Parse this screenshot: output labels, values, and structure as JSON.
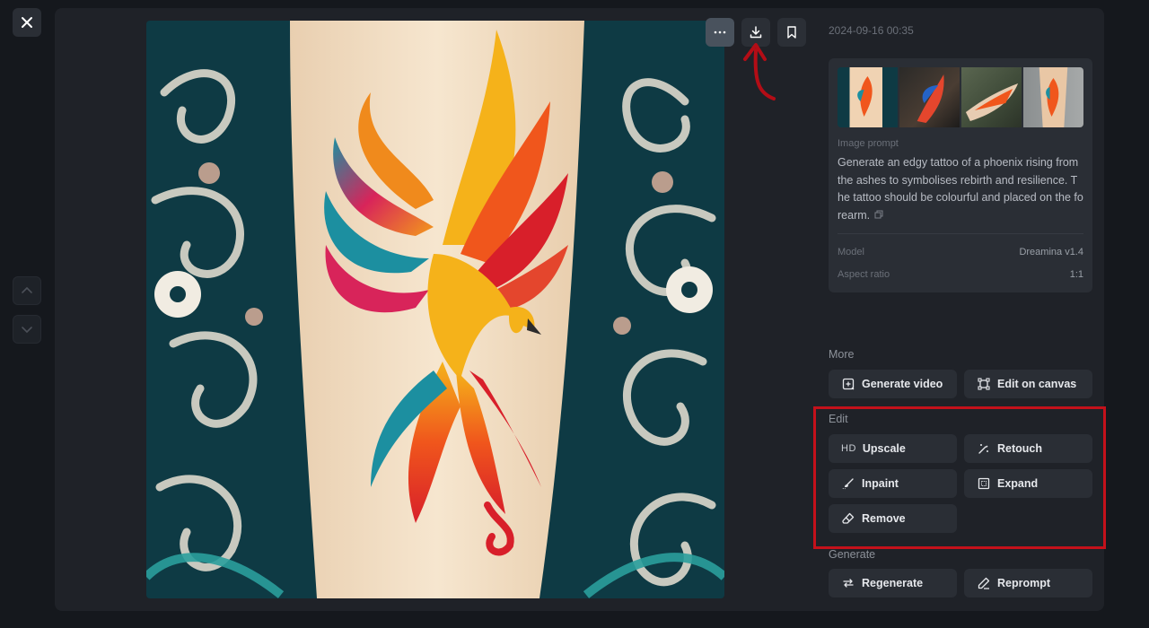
{
  "timestamp": "2024-09-16 00:35",
  "info": {
    "prompt_label": "Image prompt",
    "prompt_text": "Generate an edgy tattoo of a phoenix rising from the ashes to symbolises rebirth and resilience. The tattoo should be colourful and placed on the forearm.",
    "model_label": "Model",
    "model_value": "Dreamina v1.4",
    "ratio_label": "Aspect ratio",
    "ratio_value": "1:1"
  },
  "sections": {
    "more": "More",
    "edit": "Edit",
    "generate": "Generate"
  },
  "buttons": {
    "generate_video": "Generate video",
    "edit_on_canvas": "Edit on canvas",
    "upscale_prefix": "HD",
    "upscale": "Upscale",
    "retouch": "Retouch",
    "inpaint": "Inpaint",
    "expand": "Expand",
    "remove": "Remove",
    "regenerate": "Regenerate",
    "reprompt": "Reprompt"
  },
  "icons": {
    "close": "close-icon",
    "up": "chevron-up-icon",
    "down": "chevron-down-icon",
    "more": "more-dots-icon",
    "download": "download-icon",
    "bookmark": "bookmark-icon",
    "copy": "copy-icon"
  },
  "colors": {
    "annotation": "#c4111b",
    "panel": "#1f2228",
    "button": "#2a2e35"
  }
}
